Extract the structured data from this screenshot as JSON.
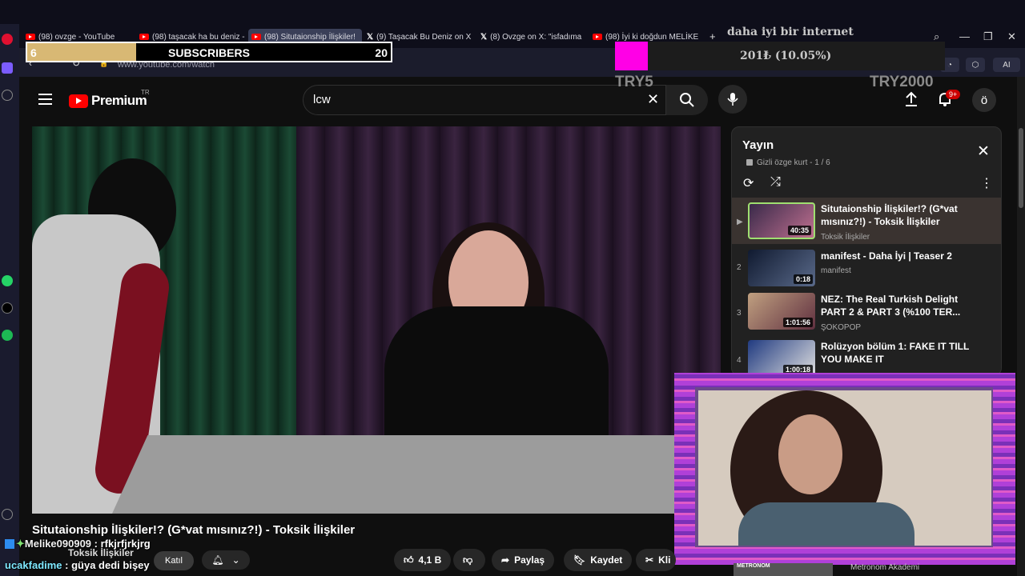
{
  "browser": {
    "tabs": [
      {
        "label": "(98) ovzge - YouTube",
        "icon": "youtube-icon"
      },
      {
        "label": "(98) taşacak ha bu deniz -",
        "icon": "youtube-icon"
      },
      {
        "label": "(98) Situtaionship İlişkiler!",
        "icon": "youtube-icon",
        "active": true
      },
      {
        "label": "(9) Taşacak Bu Deniz on X",
        "icon": "x-icon"
      },
      {
        "label": "(8) Ovzge on X: \"isfadıma",
        "icon": "x-icon"
      },
      {
        "label": "(98) İyi ki doğdun MELİKE",
        "icon": "youtube-icon"
      }
    ],
    "new_tab": "+",
    "url": "www.youtube.com/watch",
    "ai_button": "AI"
  },
  "overlay": {
    "subscribers": {
      "current": "6",
      "label": "SUBSCRIBERS",
      "goal": "20",
      "progress": 0.3
    },
    "donation": {
      "title": "daha iyi bir internet",
      "value": "201₺ (10.05%)",
      "min": "TRY5",
      "max": "TRY2000",
      "progress": 0.1005
    }
  },
  "youtube": {
    "logo_text": "Premium",
    "logo_region": "TR",
    "search_value": "lcw",
    "notification_count": "9+",
    "avatar_letter": "ö"
  },
  "video": {
    "title": "Situtaionship İlişkiler!? (G*vat mısınız?!) - Toksik İlişkiler",
    "channel": "Toksik İlişkiler",
    "join_label": "Katıl",
    "likes": "4,1 B",
    "share_label": "Paylaş",
    "save_label": "Kaydet",
    "clip_label": "Kli"
  },
  "playlist": {
    "title": "Yayın",
    "meta": "Gizli  özge kurt - 1 / 6",
    "items": [
      {
        "index": "▶",
        "title": "Situtaionship İlişkiler!? (G*vat mısınız?!) - Toksik İlişkiler",
        "channel": "Toksik İlişkiler",
        "duration": "40:35",
        "current": true
      },
      {
        "index": "2",
        "title": "manifest - Daha İyi | Teaser 2",
        "channel": "manifest",
        "duration": "0:18"
      },
      {
        "index": "3",
        "title": "NEZ: The Real Turkish Delight PART 2 & PART 3 (%100 TER...",
        "channel": "ŞOKOPOP",
        "duration": "1:01:56"
      },
      {
        "index": "4",
        "title": "Rolüzyon bölüm 1: FAKE IT TILL YOU MAKE IT",
        "channel": "",
        "duration": "1:00:18"
      }
    ]
  },
  "chat": [
    {
      "user": "Melike090909",
      "message": " : rfkjrfjrkjrg"
    },
    {
      "user": "ucakfadime",
      "message": " : güya dedi bişey"
    }
  ],
  "bottom": {
    "channel": "Metronom Akademi",
    "thumb_label": "METRONOM"
  }
}
